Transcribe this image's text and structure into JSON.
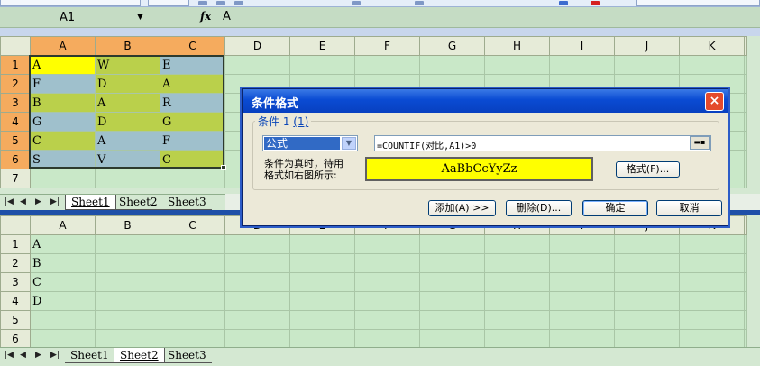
{
  "formula_bar": {
    "cell_reference": "A1",
    "fx_label": "fx",
    "formula": "A"
  },
  "top_sheet": {
    "columns": [
      "A",
      "B",
      "C",
      "D",
      "E",
      "F",
      "G",
      "H",
      "I",
      "J",
      "K"
    ],
    "rows": [
      "1",
      "2",
      "3",
      "4",
      "5",
      "6",
      "7"
    ],
    "cells": [
      [
        "A",
        "W",
        "E"
      ],
      [
        "F",
        "D",
        "A"
      ],
      [
        "B",
        "A",
        "R"
      ],
      [
        "G",
        "D",
        "G"
      ],
      [
        "C",
        "A",
        "F"
      ],
      [
        "S",
        "V",
        "C"
      ],
      [
        "",
        "",
        ""
      ]
    ],
    "tabs": [
      "Sheet1",
      "Sheet2",
      "Sheet3"
    ],
    "active_tab": "Sheet1"
  },
  "bottom_sheet": {
    "columns": [
      "A",
      "B",
      "C",
      "D",
      "E",
      "F",
      "G",
      "H",
      "I",
      "J",
      "K"
    ],
    "rows": [
      "1",
      "2",
      "3",
      "4",
      "5",
      "6"
    ],
    "cells": [
      "A",
      "B",
      "C",
      "D",
      "",
      ""
    ],
    "tabs": [
      "Sheet1",
      "Sheet2",
      "Sheet3"
    ],
    "active_tab": "Sheet2"
  },
  "colors": {
    "yellow": "#ffff00",
    "steel_blue": "#9fc0cc",
    "olive": "#bad04b",
    "selected_header": "#f5ab5e"
  },
  "dialog": {
    "title": "条件格式",
    "close_label": "×",
    "condition_label": "条件 1",
    "condition_hotkey": "(1)",
    "condition_type": "公式",
    "formula": "=COUNTIF(对比,A1)>0",
    "note_line1": "条件为真时，待用",
    "note_line2": "格式如右图所示:",
    "preview_text": "AaBbCcYyZz",
    "format_button": "格式(F)...",
    "add_button": "添加(A) >>",
    "delete_button": "删除(D)...",
    "ok_button": "确定",
    "cancel_button": "取消"
  }
}
